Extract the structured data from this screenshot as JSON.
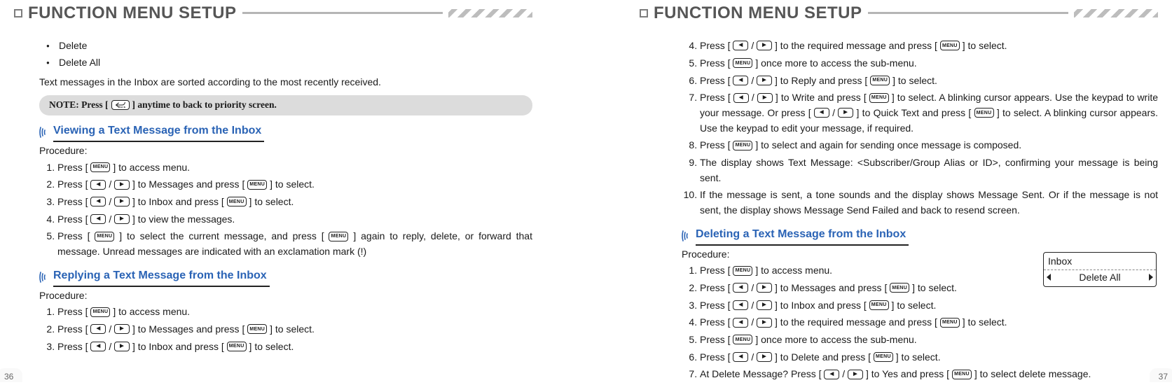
{
  "chapter_title": "FUNCTION MENU SETUP",
  "page_left_num": "36",
  "page_right_num": "37",
  "icons": {
    "menu": "MENU",
    "left": "◄",
    "right": "►"
  },
  "left_page": {
    "bullets": [
      "Delete",
      "Delete All"
    ],
    "after_bullets": "Text messages in the Inbox are sorted according to the most recently received.",
    "note_prefix": "NOTE: Press [ ",
    "note_suffix": " ]  anytime to back to priority screen.",
    "sections": [
      {
        "title": "Viewing a Text Message from the Inbox",
        "procedure_label": "Procedure:",
        "steps": [
          {
            "pre": "Press [ ",
            "mid": [
              {
                "t": "menu"
              }
            ],
            "post": " ] to access menu."
          },
          {
            "pre": "Press [ ",
            "mid": [
              {
                "t": "left"
              },
              {
                "raw": " / "
              },
              {
                "t": "right"
              }
            ],
            "post": " ] to Messages and press [ ",
            "mid2": [
              {
                "t": "menu"
              }
            ],
            "post2": " ] to select."
          },
          {
            "pre": "Press [ ",
            "mid": [
              {
                "t": "left"
              },
              {
                "raw": " / "
              },
              {
                "t": "right"
              }
            ],
            "post": " ] to Inbox and press [ ",
            "mid2": [
              {
                "t": "menu"
              }
            ],
            "post2": " ]  to select."
          },
          {
            "pre": "Press [ ",
            "mid": [
              {
                "t": "left"
              },
              {
                "raw": " / "
              },
              {
                "t": "right"
              }
            ],
            "post": " ] to view the messages."
          },
          {
            "pre": "Press [ ",
            "mid": [
              {
                "t": "menu"
              }
            ],
            "post": " ] to select the current message, and press [ ",
            "mid2": [
              {
                "t": "menu"
              }
            ],
            "post2": " ] again to reply, delete, or forward that message. Unread messages are indicated with an exclamation mark (!)",
            "justify": true
          }
        ]
      },
      {
        "title": "Replying a Text Message from the Inbox",
        "procedure_label": "Procedure:",
        "steps": [
          {
            "pre": "Press [ ",
            "mid": [
              {
                "t": "menu"
              }
            ],
            "post": " ] to access menu."
          },
          {
            "pre": "Press [ ",
            "mid": [
              {
                "t": "left"
              },
              {
                "raw": " / "
              },
              {
                "t": "right"
              }
            ],
            "post": " ] to Messages and press [ ",
            "mid2": [
              {
                "t": "menu"
              }
            ],
            "post2": " ] to select."
          },
          {
            "pre": "Press [ ",
            "mid": [
              {
                "t": "left"
              },
              {
                "raw": " / "
              },
              {
                "t": "right"
              }
            ],
            "post": " ] to Inbox and press [ ",
            "mid2": [
              {
                "t": "menu"
              }
            ],
            "post2": " ] to select."
          }
        ]
      }
    ]
  },
  "right_page": {
    "cont_steps": [
      {
        "pre": "Press [ ",
        "mid": [
          {
            "t": "left"
          },
          {
            "raw": " / "
          },
          {
            "t": "right"
          }
        ],
        "post": " ] to the required message and press [ ",
        "mid2": [
          {
            "t": "menu"
          }
        ],
        "post2": " ] to select."
      },
      {
        "pre": "Press [ ",
        "mid": [
          {
            "t": "menu"
          }
        ],
        "post": " ] once more to access the sub-menu."
      },
      {
        "pre": "Press [ ",
        "mid": [
          {
            "t": "left"
          },
          {
            "raw": " / "
          },
          {
            "t": "right"
          }
        ],
        "post": " ] to Reply and press [ ",
        "mid2": [
          {
            "t": "menu"
          }
        ],
        "post2": " ] to select."
      },
      {
        "pre": "Press [ ",
        "mid": [
          {
            "t": "left"
          },
          {
            "raw": " / "
          },
          {
            "t": "right"
          }
        ],
        "post": " ] to Write and press [ ",
        "mid2": [
          {
            "t": "menu"
          }
        ],
        "post2": " ] to select. A blinking cursor appears. Use the keypad to write your message. Or press [ ",
        "mid3": [
          {
            "t": "left"
          },
          {
            "raw": " / "
          },
          {
            "t": "right"
          }
        ],
        "post3": " ] to Quick Text and press [ ",
        "mid4": [
          {
            "t": "menu"
          }
        ],
        "post4": " ] to select. A blinking cursor appears. Use the keypad to edit your message, if required.",
        "justify": true
      },
      {
        "pre": "Press [ ",
        "mid": [
          {
            "t": "menu"
          }
        ],
        "post": " ] to select and again for sending once message is composed."
      },
      {
        "pre": "The display shows Text Message: <Subscriber/Group Alias or ID>, confirming your message is being sent.",
        "justify": true
      },
      {
        "pre": "If the message is sent, a tone sounds and the display shows Message Sent. Or if the message is not sent, the display shows Message Send Failed and back to resend screen.",
        "justify": true
      }
    ],
    "section": {
      "title": "Deleting a Text Message from the Inbox",
      "procedure_label": "Procedure:",
      "steps": [
        {
          "pre": "Press [ ",
          "mid": [
            {
              "t": "menu"
            }
          ],
          "post": " ] to access menu."
        },
        {
          "pre": "Press [ ",
          "mid": [
            {
              "t": "left"
            },
            {
              "raw": " / "
            },
            {
              "t": "right"
            }
          ],
          "post": " ] to Messages and press  [ ",
          "mid2": [
            {
              "t": "menu"
            }
          ],
          "post2": " ]  to select."
        },
        {
          "pre": "Press [ ",
          "mid": [
            {
              "t": "left"
            },
            {
              "raw": " / "
            },
            {
              "t": "right"
            }
          ],
          "post": " ] to Inbox and press [ ",
          "mid2": [
            {
              "t": "menu"
            }
          ],
          "post2": " ] to select."
        },
        {
          "pre": "Press [ ",
          "mid": [
            {
              "t": "left"
            },
            {
              "raw": " / "
            },
            {
              "t": "right"
            }
          ],
          "post": " ] to the required message and press [ ",
          "mid2": [
            {
              "t": "menu"
            }
          ],
          "post2": " ] to select."
        },
        {
          "pre": "Press [ ",
          "mid": [
            {
              "t": "menu"
            }
          ],
          "post": " ] once more to access the sub-menu."
        },
        {
          "pre": "Press [ ",
          "mid": [
            {
              "t": "left"
            },
            {
              "raw": " / "
            },
            {
              "t": "right"
            }
          ],
          "post": " ] to Delete and press  [ ",
          "mid2": [
            {
              "t": "menu"
            }
          ],
          "post2": " ] to select."
        },
        {
          "pre": "At Delete Message? Press [ ",
          "mid": [
            {
              "t": "left"
            },
            {
              "raw": " / "
            },
            {
              "t": "right"
            }
          ],
          "post": " ] to Yes and press [ ",
          "mid2": [
            {
              "t": "menu"
            }
          ],
          "post2": " ] to select delete message."
        }
      ]
    },
    "lcd": {
      "row1": "Inbox",
      "row2": "Delete All"
    }
  }
}
